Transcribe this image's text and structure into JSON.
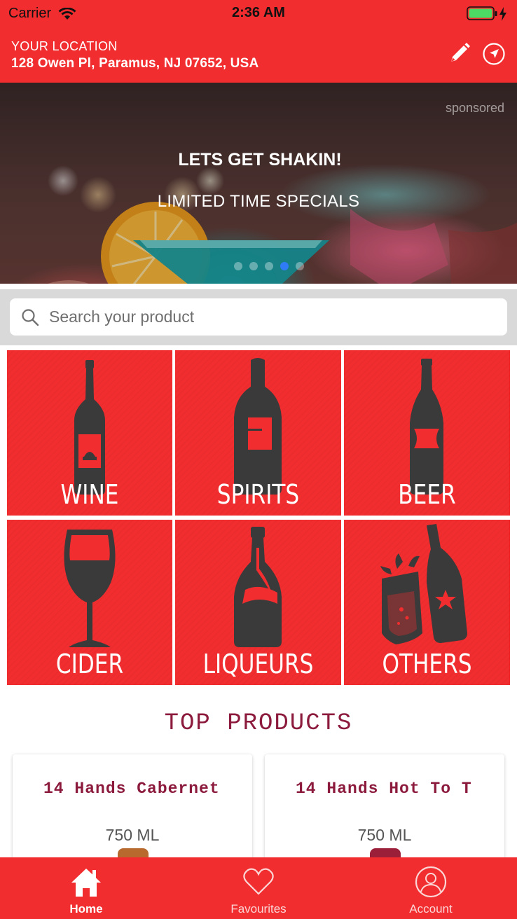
{
  "status_bar": {
    "carrier": "Carrier",
    "time": "2:36 AM"
  },
  "location": {
    "label": "YOUR LOCATION",
    "address": "128 Owen Pl, Paramus, NJ 07652, USA"
  },
  "banner": {
    "sponsored": "sponsored",
    "headline": "LETS GET SHAKIN!",
    "subline": "LIMITED TIME SPECIALS",
    "active_slide": 4,
    "slide_count": 5
  },
  "search": {
    "placeholder": "Search your product",
    "value": ""
  },
  "categories": [
    {
      "label": "WINE",
      "icon": "wine-bottle-icon"
    },
    {
      "label": "SPIRITS",
      "icon": "spirits-bottle-icon"
    },
    {
      "label": "BEER",
      "icon": "beer-bottle-icon"
    },
    {
      "label": "CIDER",
      "icon": "wine-glass-icon"
    },
    {
      "label": "LIQUEURS",
      "icon": "liqueur-bottle-icon"
    },
    {
      "label": "OTHERS",
      "icon": "cheers-icon"
    }
  ],
  "top_products": {
    "title": "TOP PRODUCTS",
    "items": [
      {
        "name": "14 Hands Cabernet",
        "size": "750 ML",
        "bottle_color": "#b86a2e"
      },
      {
        "name": "14 Hands Hot To T",
        "size": "750 ML",
        "bottle_color": "#9c1f3a"
      }
    ]
  },
  "tabs": [
    {
      "label": "Home",
      "icon": "home-icon",
      "active": true
    },
    {
      "label": "Favourites",
      "icon": "heart-icon",
      "active": false
    },
    {
      "label": "Account",
      "icon": "account-icon",
      "active": false
    }
  ],
  "colors": {
    "brand_red": "#f12d2f",
    "maroon_text": "#8b1a3d",
    "active_dot": "#2f7cf6",
    "icon_dark": "#3a3a3a"
  }
}
